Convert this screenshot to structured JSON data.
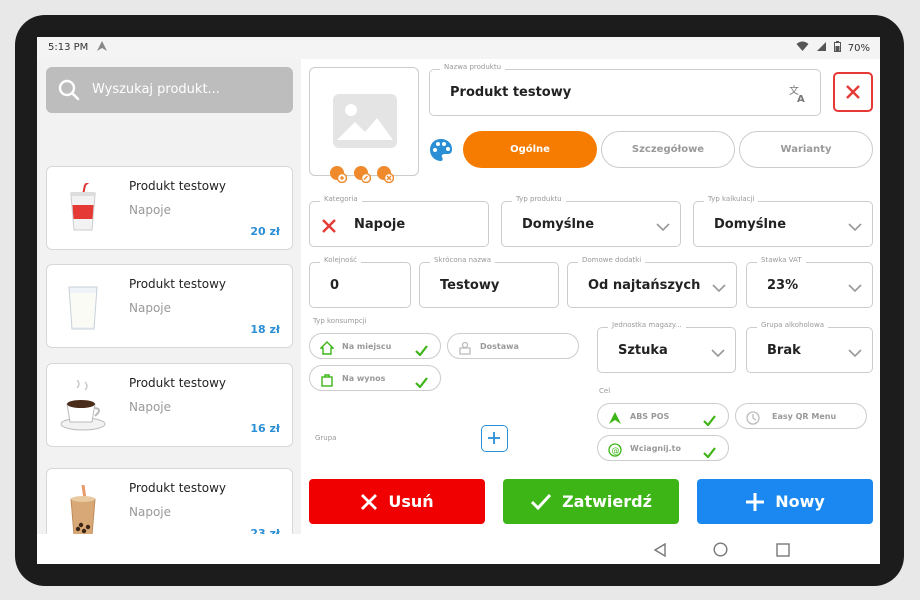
{
  "status": {
    "time": "5:13 PM",
    "battery": "70%"
  },
  "search": {
    "placeholder": "Wyszukaj produkt..."
  },
  "products": [
    {
      "name": "Produkt testowy",
      "category": "Napoje",
      "price": "20 zł",
      "icon": "soda-cup-icon"
    },
    {
      "name": "Produkt testowy",
      "category": "Napoje",
      "price": "18 zł",
      "icon": "milk-glass-icon"
    },
    {
      "name": "Produkt testowy",
      "category": "Napoje",
      "price": "16 zł",
      "icon": "coffee-cup-icon"
    },
    {
      "name": "Produkt testowy",
      "category": "Napoje",
      "price": "23 zł",
      "icon": "bubble-tea-icon"
    }
  ],
  "form": {
    "product_name_label": "Nazwa produktu",
    "product_name": "Produkt testowy",
    "tabs": [
      "Ogólne",
      "Szczegółowe",
      "Warianty"
    ],
    "category_label": "Kategoria",
    "category": "Napoje",
    "product_type_label": "Typ produktu",
    "product_type": "Domyślne",
    "calc_type_label": "Typ kalkulacji",
    "calc_type": "Domyślne",
    "order_label": "Kolejność",
    "order": "0",
    "short_name_label": "Skrócona nazwa",
    "short_name": "Testowy",
    "addons_label": "Domowe dodatki",
    "addons": "Od najtańszych",
    "vat_label": "Stawka VAT",
    "vat": "23%",
    "consumption_label": "Typ konsumpcji",
    "consumption": [
      {
        "label": "Na miejscu",
        "checked": true
      },
      {
        "label": "Dostawa",
        "checked": false
      },
      {
        "label": "Na wynos",
        "checked": true
      }
    ],
    "unit_label": "Jednostka magazy...",
    "unit": "Sztuka",
    "alcohol_label": "Grupa alkoholowa",
    "alcohol": "Brak",
    "target_label": "Cel",
    "targets": [
      {
        "label": "ABS POS",
        "checked": true
      },
      {
        "label": "Easy QR Menu",
        "checked": false
      },
      {
        "label": "Wciagnij.to",
        "checked": true
      }
    ],
    "group_label": "Grupa"
  },
  "buttons": {
    "delete": "Usuń",
    "confirm": "Zatwierdź",
    "new": "Nowy"
  },
  "colors": {
    "orange": "#f57c00",
    "red": "#f00000",
    "green": "#3db517",
    "blue": "#1a88f0",
    "price": "#2b8fd6"
  }
}
